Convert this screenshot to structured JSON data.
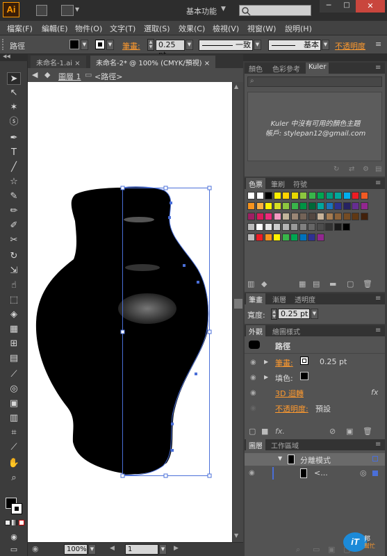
{
  "app": {
    "logo_text": "Ai",
    "workspace": "基本功能",
    "window_min": "─",
    "window_max": "□",
    "window_close": "✕"
  },
  "menu": [
    "檔案(F)",
    "編輯(E)",
    "物件(O)",
    "文字(T)",
    "選取(S)",
    "效果(C)",
    "檢視(V)",
    "視窗(W)",
    "說明(H)"
  ],
  "control": {
    "object_type": "路徑",
    "stroke_label": "筆畫:",
    "stroke_value": "0.25 pt",
    "profile_label": "一致",
    "brush_label": "基本",
    "opacity_label": "不透明度"
  },
  "document_tabs": [
    {
      "label": "未命名-1.ai",
      "close": "×",
      "active": false
    },
    {
      "label": "未命名-2* @ 100% (CMYK/預視)",
      "close": "×",
      "active": true
    }
  ],
  "breadcrumb": {
    "layer": "圖層 1",
    "path": "<路徑>"
  },
  "status": {
    "zoom": "100%",
    "page": "1"
  },
  "color_panel": {
    "tabs": [
      "顏色",
      "色彩參考",
      "Kuler"
    ],
    "active": "Kuler",
    "message_line1": "Kuler 中沒有可用的顏色主題",
    "message_line2": "帳戶: stylepan12@gmail.com"
  },
  "swatches_panel": {
    "tabs": [
      "色票",
      "筆刷",
      "符號"
    ],
    "active": "色票",
    "row1": [
      "#ffffff",
      "#ffffff",
      "#000000",
      "#ffef00",
      "#ffd400",
      "#e8d800",
      "#8cc63f",
      "#39b54a",
      "#00a651",
      "#009e7f",
      "#00a99d",
      "#00aeef",
      "#ed1c24",
      "#f15a24"
    ],
    "row2": [
      "#f7941d",
      "#fbb040",
      "#fff200",
      "#d7df23",
      "#8dc63f",
      "#39b54a",
      "#009444",
      "#006838",
      "#00a79d",
      "#1b75bc",
      "#2e3192",
      "#262262",
      "#662d91",
      "#92278f"
    ],
    "row3": [
      "#9e1f63",
      "#da1c5c",
      "#ee2a7b",
      "#f49ac1",
      "#c2b59b",
      "#998675",
      "#736357",
      "#534741",
      "#c7b299",
      "#a67c52",
      "#8c6239",
      "#754c24",
      "#603813",
      "#42210b"
    ],
    "row4": [
      "#ffffff",
      "#e6e6e6",
      "#cccccc",
      "#b3b3b3",
      "#999999",
      "#808080",
      "#666666",
      "#4d4d4d",
      "#333333",
      "#1a1a1a",
      "#000000"
    ],
    "row5": [
      "#ed1c24",
      "#f7941d",
      "#fff200",
      "#39b54a",
      "#00a651",
      "#0072bc",
      "#2e3192",
      "#92278f"
    ]
  },
  "stroke_panel": {
    "tabs": [
      "筆畫",
      "漸層",
      "透明度"
    ],
    "active": "筆畫",
    "weight_label": "寬度:",
    "weight_value": "0.25 pt"
  },
  "appearance_panel": {
    "tabs": [
      "外觀",
      "繪圖樣式"
    ],
    "active": "外觀",
    "title": "路徑",
    "stroke_label": "筆畫:",
    "stroke_value": "0.25 pt",
    "fill_label": "填色:",
    "effect_label": "3D 迴轉",
    "effect_badge": "fx",
    "opacity_label": "不透明度:",
    "opacity_value": "預設"
  },
  "layers_panel": {
    "tabs": [
      "圖層",
      "工作區域"
    ],
    "active": "圖層",
    "layer_name": "分離模式",
    "sub_name": "<..."
  },
  "tools": [
    "selection-tool",
    "direct-selection-tool",
    "magic-wand-tool",
    "lasso-tool",
    "pen-tool",
    "type-tool",
    "line-tool",
    "rectangle-tool",
    "paintbrush-tool",
    "pencil-tool",
    "blob-brush-tool",
    "eraser-tool",
    "rotate-tool",
    "scale-tool",
    "width-tool",
    "free-transform-tool",
    "shape-builder-tool",
    "perspective-grid-tool",
    "mesh-tool",
    "gradient-tool",
    "eyedropper-tool",
    "blend-tool",
    "symbol-sprayer-tool",
    "column-graph-tool",
    "artboard-tool",
    "slice-tool",
    "hand-tool",
    "zoom-tool"
  ],
  "colors": {
    "accent_orange": "#ff9a00",
    "selection_blue": "#4a6fd8"
  }
}
